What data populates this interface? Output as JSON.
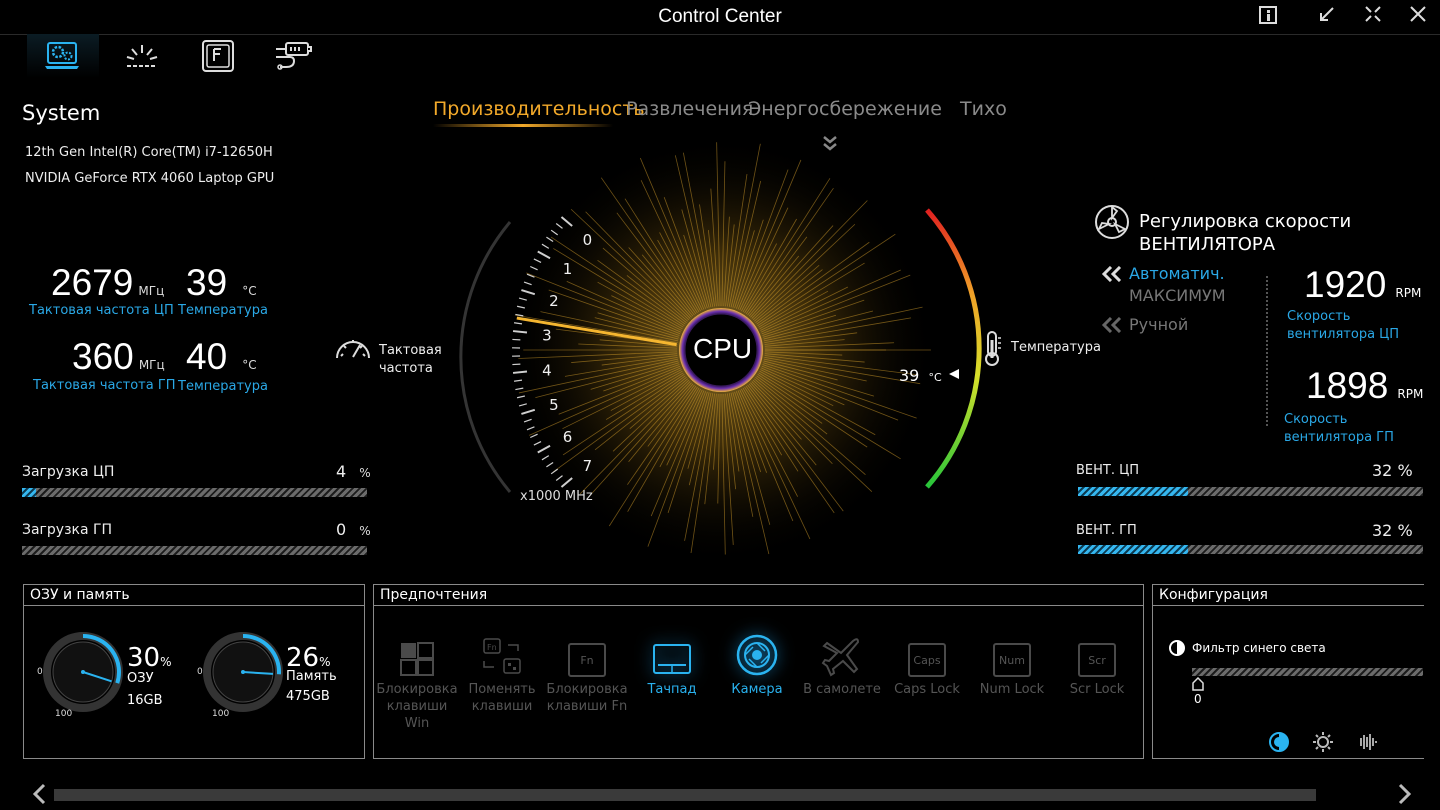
{
  "window": {
    "title": "Control Center"
  },
  "system": {
    "title": "System",
    "cpu_name": "12th Gen Intel(R) Core(TM) i7-12650H",
    "gpu_name": "NVIDIA GeForce RTX 4060 Laptop GPU",
    "cpu_clock": {
      "value": "2679",
      "unit": "МГц",
      "label": "Тактовая частота ЦП"
    },
    "cpu_temp": {
      "value": "39",
      "unit": "°C",
      "label": "Температура"
    },
    "gpu_clock": {
      "value": "360",
      "unit": "МГц",
      "label": "Тактовая частота ГП"
    },
    "gpu_temp": {
      "value": "40",
      "unit": "°C",
      "label": "Температура"
    },
    "cpu_load": {
      "label": "Загрузка ЦП",
      "value": "4",
      "unit": "%",
      "percent": 4
    },
    "gpu_load": {
      "label": "Загрузка ГП",
      "value": "0",
      "unit": "%",
      "percent": 0
    }
  },
  "modes": {
    "performance": "Производительность",
    "entertainment": "Развлечения",
    "power_saving": "Энергосбережение",
    "quiet": "Тихо"
  },
  "gauge": {
    "center_label": "CPU",
    "clock_label": "Тактовая частота",
    "temp_label": "Температура",
    "scale_unit": "x1000 MHz",
    "ticks": [
      "0",
      "1",
      "2",
      "3",
      "4",
      "5",
      "6",
      "7"
    ],
    "clock_value_ghz": 2.679,
    "temp_value": "39",
    "temp_unit": "°C"
  },
  "fan": {
    "title_line1": "Регулировка скорости",
    "title_line2": "ВЕНТИЛЯТОРА",
    "auto_label": "Автоматич.",
    "max_label": "МАКСИМУМ",
    "manual_label": "Ручной",
    "cpu_rpm": "1920",
    "gpu_rpm": "1898",
    "rpm_unit": "RPM",
    "cpu_label": "Скорость вентилятора ЦП",
    "gpu_label": "Скорость вентилятора ГП",
    "cpu_fan": {
      "label": "ВЕНТ. ЦП",
      "value": "32",
      "unit": "%",
      "percent": 32
    },
    "gpu_fan": {
      "label": "ВЕНТ. ГП",
      "value": "32",
      "unit": "%",
      "percent": 32
    }
  },
  "memory": {
    "title": "ОЗУ и память",
    "ram": {
      "percent": 30,
      "value": "30",
      "unit": "%",
      "label": "ОЗУ",
      "size": "16GB"
    },
    "storage": {
      "percent": 26,
      "value": "26",
      "unit": "%",
      "label": "Память",
      "size": "475GB"
    },
    "dial_min": "0",
    "dial_max": "100"
  },
  "preferences": {
    "title": "Предпочтения",
    "items": [
      {
        "label": "Блокировка клавиши Win",
        "icon": "win-lock-icon",
        "on": false
      },
      {
        "label": "Поменять клавиши",
        "icon": "swap-keys-icon",
        "on": false
      },
      {
        "label": "Блокировка клавиши Fn",
        "icon": "fn-lock-icon",
        "on": false,
        "cap": "Fn"
      },
      {
        "label": "Тачпад",
        "icon": "touchpad-icon",
        "on": true
      },
      {
        "label": "Камера",
        "icon": "camera-icon",
        "on": true
      },
      {
        "label": "В самолете",
        "icon": "airplane-icon",
        "on": false
      },
      {
        "label": "Caps Lock",
        "icon": "caps-lock-icon",
        "on": false,
        "cap": "Caps"
      },
      {
        "label": "Num Lock",
        "icon": "num-lock-icon",
        "on": false,
        "cap": "Num"
      },
      {
        "label": "Scr Lock",
        "icon": "scroll-lock-icon",
        "on": false,
        "cap": "Scr"
      }
    ]
  },
  "config": {
    "title": "Конфигурация",
    "blue_light_label": "Фильтр синего света",
    "blue_light_value": "0"
  },
  "colors": {
    "accent_blue": "#2aa8e6",
    "accent_orange": "#f2a92a",
    "background": "#000000"
  }
}
